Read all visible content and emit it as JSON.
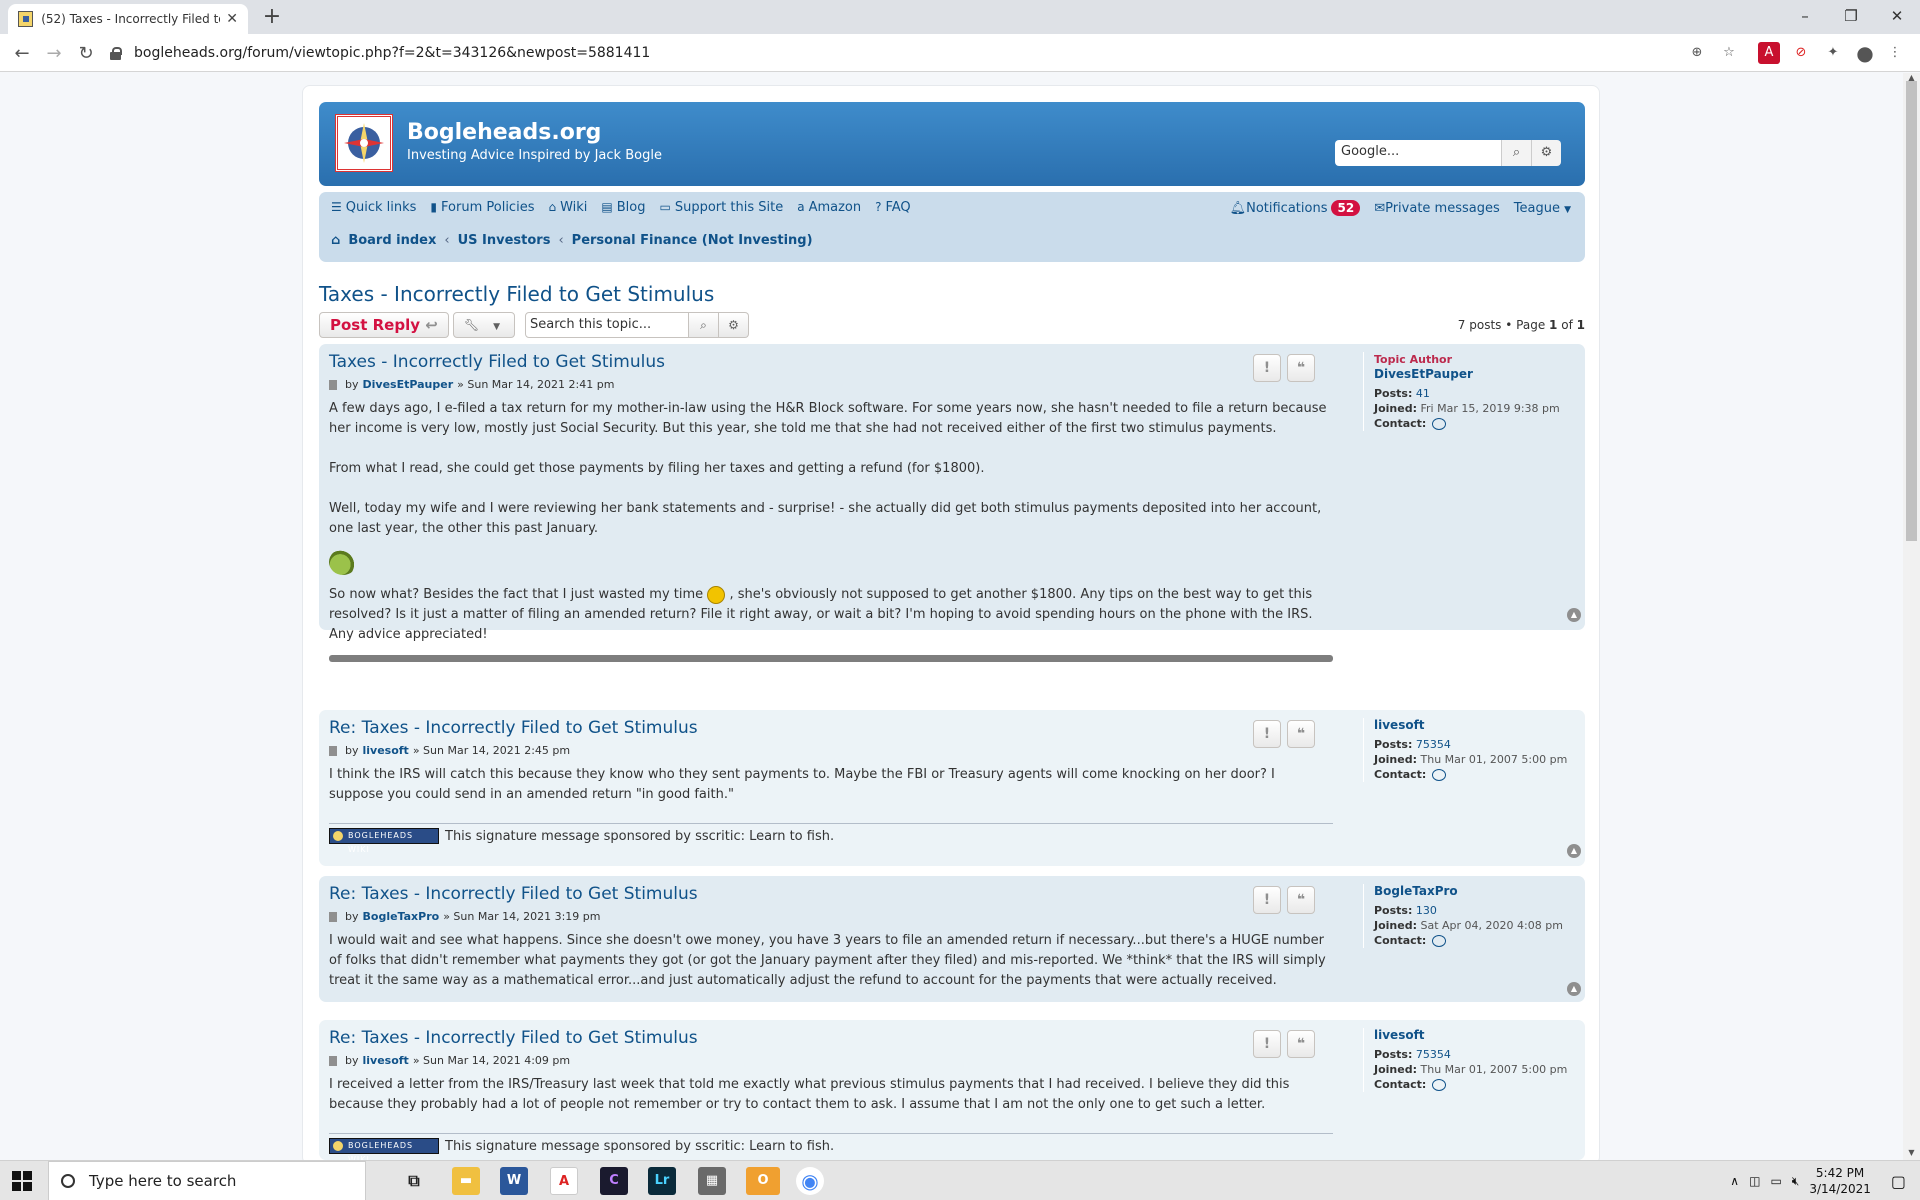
{
  "browser": {
    "tab_title": "(52) Taxes - Incorrectly Filed to Get Stimulus",
    "tab_close": "✕",
    "new_tab": "+",
    "url": "bogleheads.org/forum/viewtopic.php?f=2&t=343126&newpost=5881411",
    "window_controls": [
      "–",
      "❐",
      "✕"
    ]
  },
  "site": {
    "name": "Bogleheads.org",
    "tagline": "Investing Advice Inspired by Jack Bogle",
    "search_placeholder": "Google..."
  },
  "nav": {
    "quick_links": "Quick links",
    "forum_policies": "Forum Policies",
    "wiki": "Wiki",
    "blog": "Blog",
    "support": "Support this Site",
    "amazon": "Amazon",
    "faq": "FAQ",
    "notifications": "Notifications",
    "notifications_count": "52",
    "private_messages": "Private messages",
    "user": "Teague"
  },
  "breadcrumbs": [
    "Board index",
    "US Investors",
    "Personal Finance (Not Investing)"
  ],
  "topic": {
    "title": "Taxes - Incorrectly Filed to Get Stimulus",
    "post_reply": "Post Reply",
    "search_placeholder": "Search this topic...",
    "pagination": {
      "posts": "7 posts",
      "sep": "•",
      "page_word": "Page",
      "current": "1",
      "of_word": "of",
      "total": "1"
    }
  },
  "posts": [
    {
      "title": "Taxes - Incorrectly Filed to Get Stimulus",
      "by": "by",
      "author": "DivesEtPauper",
      "date": "» Sun Mar 14, 2021 2:41 pm",
      "paragraphs": [
        "A few days ago, I e-filed a tax return for my mother-in-law using the H&R Block software. For some years now, she hasn't needed to file a return because her income is very low, mostly just Social Security. But this year, she told me that she had not received either of the first two stimulus payments.",
        "From what I read, she could get those payments by filing her taxes and getting a refund (for $1800).",
        "Well, today my wife and I were reviewing her bank statements and - surprise! - she actually did get both stimulus payments deposited into her account, one last year, the other this past January."
      ],
      "para_last_before": "So now what? Besides the fact that I just wasted my time",
      "para_last_after": ", she's obviously not supposed to get another $1800. Any tips on the best way to get this resolved? Is it just a matter of filing an amended return? File it right away, or wait a bit? I'm hoping to avoid spending hours on the phone with the IRS. Any advice appreciated!",
      "profile": {
        "role": "Topic Author",
        "name": "DivesEtPauper",
        "posts_label": "Posts:",
        "posts": "41",
        "joined_label": "Joined:",
        "joined": "Fri Mar 15, 2019 9:38 pm",
        "contact_label": "Contact:"
      }
    },
    {
      "title": "Re: Taxes - Incorrectly Filed to Get Stimulus",
      "by": "by",
      "author": "livesoft",
      "date": "» Sun Mar 14, 2021 2:45 pm",
      "text": "I think the IRS will catch this because they know who they sent payments to. Maybe the FBI or Treasury agents will come knocking on her door? I suppose you could send in an amended return \"in good faith.\"",
      "signature": "This signature message sponsored by sscritic: Learn to fish.",
      "sig_badge": "BOGLEHEADS WIKI",
      "profile": {
        "name": "livesoft",
        "posts_label": "Posts:",
        "posts": "75354",
        "joined_label": "Joined:",
        "joined": "Thu Mar 01, 2007 5:00 pm",
        "contact_label": "Contact:"
      }
    },
    {
      "title": "Re: Taxes - Incorrectly Filed to Get Stimulus",
      "by": "by",
      "author": "BogleTaxPro",
      "date": "» Sun Mar 14, 2021 3:19 pm",
      "text": "I would wait and see what happens. Since she doesn't owe money, you have 3 years to file an amended return if necessary...but there's a HUGE number of folks that didn't remember what payments they got (or got the January payment after they filed) and mis-reported. We *think* that the IRS will simply treat it the same way as a mathematical error...and just automatically adjust the refund to account for the payments that were actually received.",
      "profile": {
        "name": "BogleTaxPro",
        "posts_label": "Posts:",
        "posts": "130",
        "joined_label": "Joined:",
        "joined": "Sat Apr 04, 2020 4:08 pm",
        "contact_label": "Contact:"
      }
    },
    {
      "title": "Re: Taxes - Incorrectly Filed to Get Stimulus",
      "by": "by",
      "author": "livesoft",
      "date": "» Sun Mar 14, 2021 4:09 pm",
      "text": "I received a letter from the IRS/Treasury last week that told me exactly what previous stimulus payments that I had received. I believe they did this because they probably had a lot of people not remember or try to contact them to ask. I assume that I am not the only one to get such a letter.",
      "signature": "This signature message sponsored by sscritic: Learn to fish.",
      "sig_badge": "BOGLEHEADS WIKI",
      "profile": {
        "name": "livesoft",
        "posts_label": "Posts:",
        "posts": "75354",
        "joined_label": "Joined:",
        "joined": "Thu Mar 01, 2007 5:00 pm",
        "contact_label": "Contact:"
      }
    }
  ],
  "taskbar": {
    "search_placeholder": "Type here to search",
    "time": "5:42 PM",
    "date": "3/14/2021"
  },
  "colors": {
    "header_blue": "#2d7ab8",
    "nav_bg": "#cadceb",
    "link": "#105289",
    "post_reply_red": "#d31141",
    "topic_author": "#bc2a4d"
  }
}
